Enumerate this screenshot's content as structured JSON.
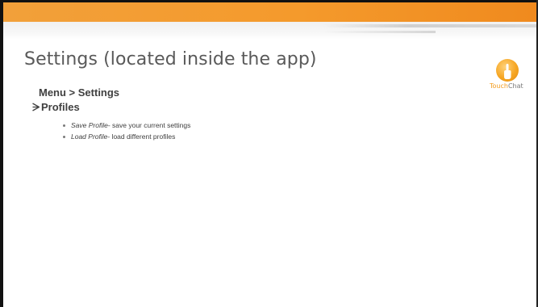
{
  "slide": {
    "title": "Settings (located inside the app)",
    "menu_path": "Menu > Settings",
    "section": "Profiles",
    "bullets": [
      {
        "term": "Save Profile",
        "desc": "- save your current settings"
      },
      {
        "term": "Load Profile",
        "desc": "- load different profiles"
      }
    ]
  },
  "logo": {
    "part1": "Touch",
    "part2": "Chat",
    "icon": "hand-pointer-icon"
  },
  "colors": {
    "accent_orange": "#f49a2c",
    "text_gray": "#404040",
    "title_gray": "#595959"
  }
}
